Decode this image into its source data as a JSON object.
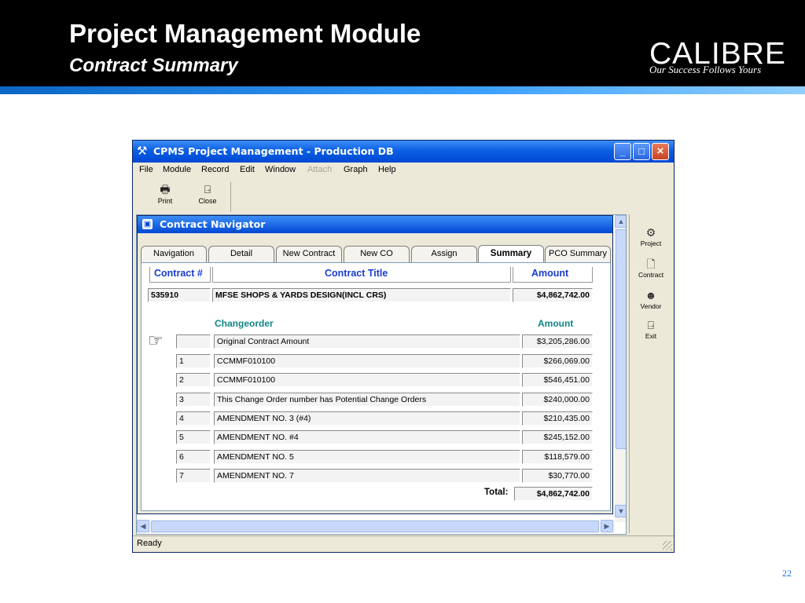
{
  "slide": {
    "title": "Project Management Module",
    "subtitle": "Contract Summary",
    "logo_word": "CALIBRE",
    "logo_tagline": "Our Success Follows Yours",
    "page_number": "22",
    "colors": {
      "header": "#000000",
      "stripe": "#1a7fe8",
      "page_number": "#1f6fd8"
    }
  },
  "window": {
    "title": "CPMS Project Management - Production DB",
    "controls": {
      "minimize": "_",
      "maximize": "□",
      "close": "×"
    }
  },
  "menu": {
    "file": "File",
    "module": "Module",
    "record": "Record",
    "edit": "Edit",
    "window": "Window",
    "attach": "Attach",
    "graph": "Graph",
    "help": "Help"
  },
  "toolbar": {
    "print": "Print",
    "close": "Close"
  },
  "navigator": {
    "title": "Contract Navigator",
    "tabs": [
      "Navigation",
      "Detail",
      "New Contract",
      "New CO",
      "Assign",
      "Summary",
      "PCO Summary"
    ],
    "active_tab": "Summary"
  },
  "summary": {
    "headers": {
      "contract_num": "Contract #",
      "contract_title": "Contract Title",
      "amount": "Amount"
    },
    "contract": {
      "number": "535910",
      "title": "MFSE SHOPS & YARDS DESIGN(INCL CRS)",
      "amount": "$4,862,742.00"
    },
    "co_headers": {
      "changeorder": "Changeorder",
      "amount": "Amount"
    },
    "change_orders": [
      {
        "num": "",
        "desc": "Original Contract Amount",
        "amount": "$3,205,286.00"
      },
      {
        "num": "1",
        "desc": "CCMMF010100",
        "amount": "$266,069.00"
      },
      {
        "num": "2",
        "desc": "CCMMF010100",
        "amount": "$546,451.00"
      },
      {
        "num": "3",
        "desc": "This Change Order number has Potential Change Orders",
        "amount": "$240,000.00"
      },
      {
        "num": "4",
        "desc": "AMENDMENT NO. 3 (#4)",
        "amount": "$210,435.00"
      },
      {
        "num": "5",
        "desc": "AMENDMENT NO. #4",
        "amount": "$245,152.00"
      },
      {
        "num": "6",
        "desc": "AMENDMENT NO. 5",
        "amount": "$118,579.00"
      },
      {
        "num": "7",
        "desc": "AMENDMENT NO. 7",
        "amount": "$30,770.00"
      }
    ],
    "total_label": "Total:",
    "total_amount": "$4,862,742.00"
  },
  "side_panel": {
    "project": "Project",
    "contract": "Contract",
    "vendor": "Vendor",
    "exit": "Exit"
  },
  "status": {
    "text": "Ready"
  }
}
